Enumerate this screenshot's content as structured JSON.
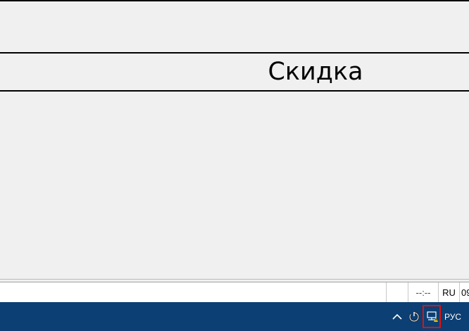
{
  "content": {
    "discount_label": "Скидка"
  },
  "status_bar": {
    "main_text": "",
    "empty_cell": "",
    "time": "--:--",
    "language": "RU",
    "clipped": "09"
  },
  "taskbar": {
    "tray": {
      "chevron_icon": "chevron-up-icon",
      "power_icon": "power-icon",
      "network_icon": "network-icon",
      "language": "РУС"
    },
    "highlight_color": "#e01010",
    "background": "#0c3f74"
  }
}
